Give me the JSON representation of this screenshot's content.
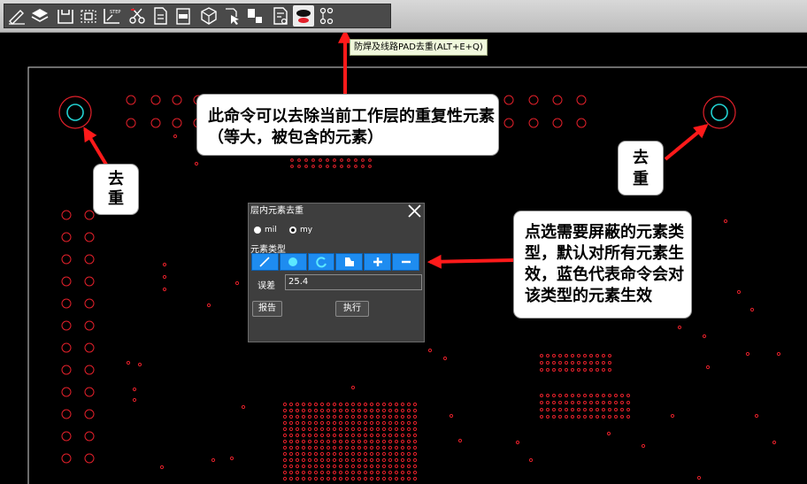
{
  "toolbar": {
    "buttons": [
      {
        "icon": "pen-icon"
      },
      {
        "icon": "layers-icon"
      },
      {
        "icon": "save-icon"
      },
      {
        "icon": "select-frame-icon"
      },
      {
        "icon": "step-export-icon",
        "label": "STEP"
      },
      {
        "icon": "scissors-icon"
      },
      {
        "icon": "document-export-icon"
      },
      {
        "icon": "pdf-export-icon"
      },
      {
        "icon": "3d-box-icon"
      },
      {
        "icon": "cursor-doc-icon"
      },
      {
        "icon": "components-icon"
      },
      {
        "icon": "report-doc-icon"
      },
      {
        "icon": "dedupe-pad-icon"
      },
      {
        "icon": "net-check-icon"
      }
    ],
    "tooltip": "防焊及线路PAD去重(ALT+E+Q)"
  },
  "callouts": {
    "top": "此命令可以去除当前工作层的重复性元素（等大，被包含的元素）",
    "left": "去\n重",
    "right": "去\n重",
    "side": "点选需要屏蔽的元素类型，默认对所有元素生效，蓝色代表命令会对该类型的元素生效"
  },
  "dialog": {
    "title": "层内元素去重",
    "unit_options": [
      "mil",
      "my"
    ],
    "selected_unit": "my",
    "types_label": "元素类型",
    "types": [
      "line-icon",
      "pad-circle-icon",
      "arc-icon",
      "surface-icon",
      "plus-icon",
      "minus-icon"
    ],
    "tolerance_label": "误差",
    "tolerance_value": "25.4",
    "report_button": "报告",
    "execute_button": "执行"
  },
  "colors": {
    "accent": "#1e8cf0",
    "board_element": "#e2202a",
    "arrow": "#ff1a1a",
    "highlight": "#22d0d0"
  }
}
